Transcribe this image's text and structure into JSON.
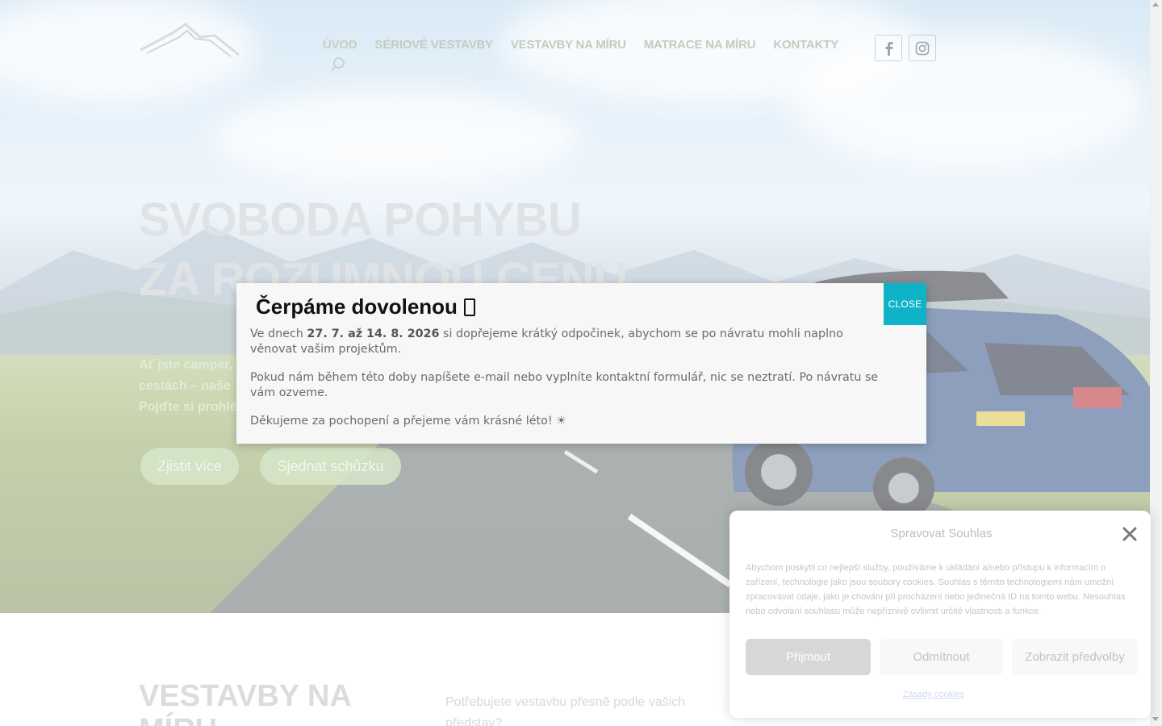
{
  "header": {
    "nav": [
      "ÚVOD",
      "SÉRIOVÉ VESTAVBY",
      "VESTAVBY NA MÍRU",
      "MATRACE NA MÍRU",
      "KONTAKTY"
    ]
  },
  "hero": {
    "title_line1": "SVOBODA POHYBU",
    "title_line2": "ZA ROZUMNOU CENU",
    "text_line1": " Ať jste camper,",
    "text_line2": "cestách – naše",
    "text_line3": "Pojďte si prohlé",
    "btn_more": "Zjistit více",
    "btn_meeting": "Sjednat schůzku"
  },
  "section": {
    "title_line1": "VESTAVBY NA",
    "title_line2": "MÍRU",
    "text": "Potřebujete vestavbu přesně podle vašich představ?"
  },
  "modal": {
    "title": "Čerpáme dovolenou",
    "close_label": "CLOSE",
    "p1_before": "Ve dnech ",
    "p1_dates": "27. 7. až 14. 8. 2026",
    "p1_after": " si dopřejeme krátký odpočinek, abychom se po návratu mohli naplno věnovat vašim projektům.",
    "p2": "Pokud nám během této doby napíšete e-mail nebo vyplníte kontaktní formulář, nic se neztratí. Po návratu se vám ozveme.",
    "p3": "Děkujeme za pochopení a přejeme vám krásné léto! ☀"
  },
  "cookie": {
    "title": "Spravovat Souhlas",
    "text": "Abychom poskytli co nejlepší služby, používáme k ukládání a/nebo přístupu k informacím o zařízení, technologie jako jsou soubory cookies. Souhlas s těmito technologiemi nám umožní zpracovávat údaje, jako je chování při procházení nebo jedinečná ID na tomto webu. Nesouhlas nebo odvolání souhlasu může nepříznivě ovlivnit určité vlastnosti a funkce.",
    "accept": "Přijmout",
    "deny": "Odmítnout",
    "prefs": "Zobrazit předvolby",
    "policy_link": "Zásady cookies"
  },
  "colors": {
    "modal_close_bg": "#0fb3c8",
    "hero_button_bg": "#d6e6c9",
    "cookie_accept_bg": "#d7d7d7"
  },
  "icons": [
    "logo-mountain",
    "search-icon",
    "facebook-icon",
    "instagram-icon",
    "close-x-icon"
  ]
}
